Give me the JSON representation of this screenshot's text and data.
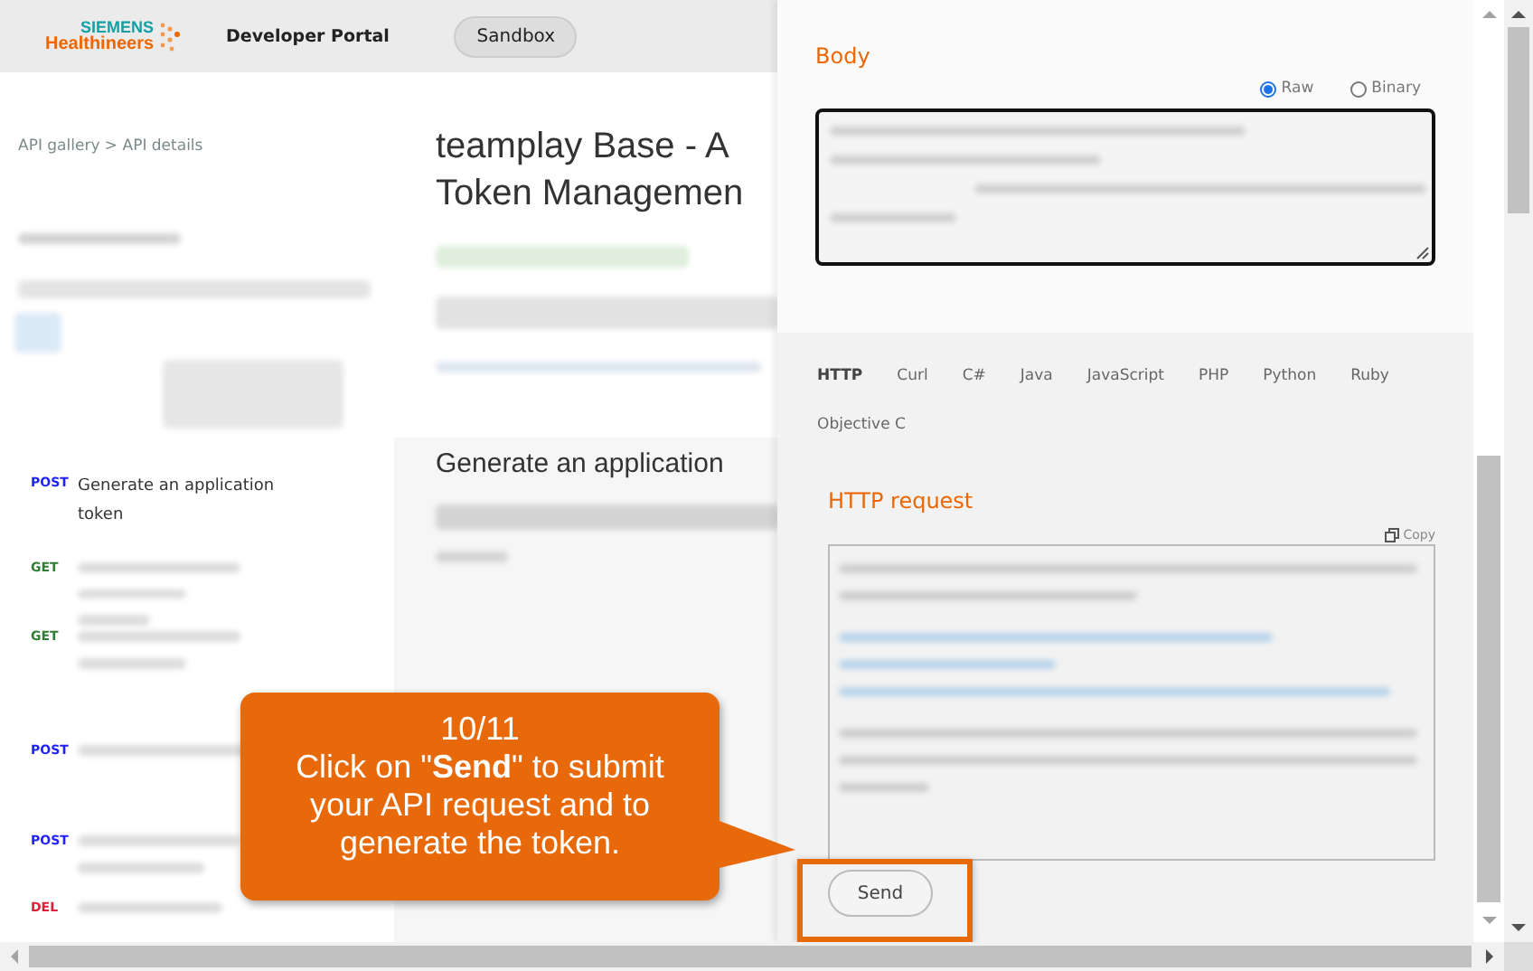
{
  "header": {
    "logo_top": "SIEMENS",
    "logo_bottom": "Healthineers",
    "portal": "Developer Portal",
    "environment_button": "Sandbox"
  },
  "breadcrumb": "API gallery > API details",
  "operations": [
    {
      "method": "POST",
      "color": "#2020ff",
      "name": "Generate an application token"
    },
    {
      "method": "GET",
      "color": "#2e7d32"
    },
    {
      "method": "GET",
      "color": "#2e7d32"
    },
    {
      "method": "POST",
      "color": "#2020ff"
    },
    {
      "method": "POST",
      "color": "#2020ff"
    },
    {
      "method": "DEL",
      "color": "#e0203a"
    }
  ],
  "title_lines": [
    "teamplay Base - A",
    "Token Managemen"
  ],
  "section_title": "Generate an application",
  "body_panel": {
    "title": "Body",
    "formats": [
      {
        "label": "Raw",
        "selected": true
      },
      {
        "label": "Binary",
        "selected": false
      }
    ]
  },
  "code_tabs": [
    {
      "label": "HTTP",
      "selected": true
    },
    {
      "label": "Curl",
      "selected": false
    },
    {
      "label": "C#",
      "selected": false
    },
    {
      "label": "Java",
      "selected": false
    },
    {
      "label": "JavaScript",
      "selected": false
    },
    {
      "label": "PHP",
      "selected": false
    },
    {
      "label": "Python",
      "selected": false
    },
    {
      "label": "Ruby",
      "selected": false
    },
    {
      "label": "Objective C",
      "selected": false
    }
  ],
  "request_panel": {
    "title": "HTTP request",
    "copy": "Copy",
    "send": "Send"
  },
  "callout": {
    "step": "10/11",
    "message": "Click on \"**Send**\" to submit your API request and to generate the token."
  }
}
